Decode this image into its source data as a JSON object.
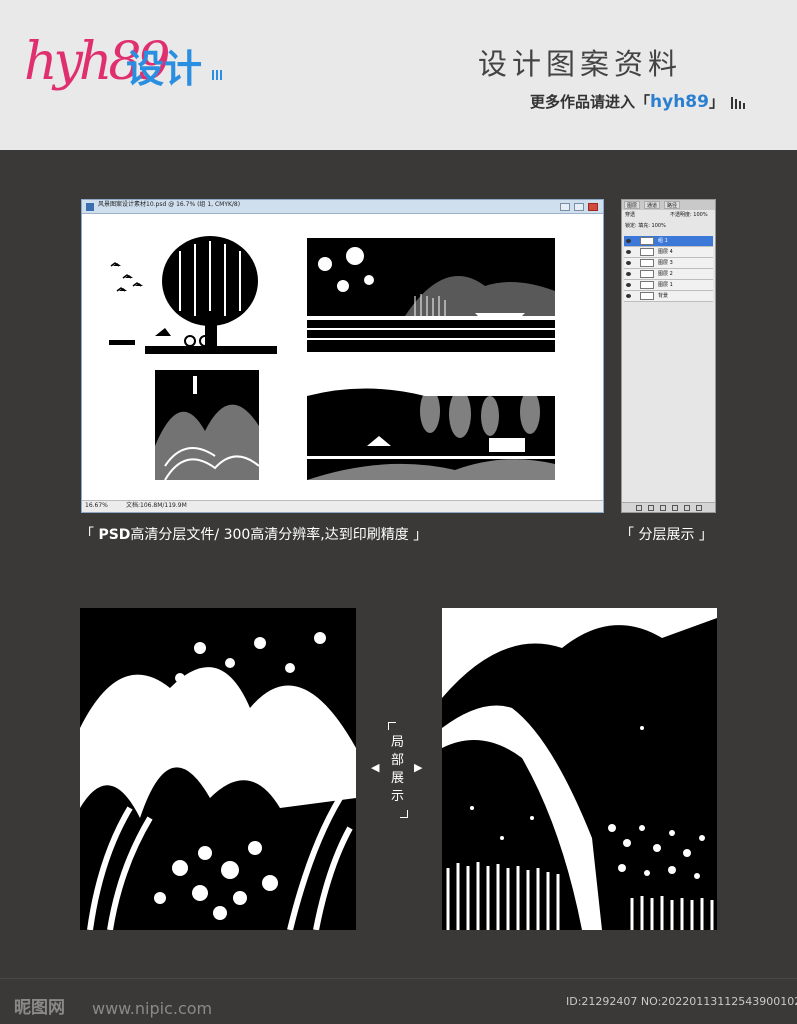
{
  "header": {
    "logo_latin": "hyh89",
    "logo_cn": "设计",
    "title": "设计图案资料",
    "subtitle_prefix": "更多作品请进入「",
    "subtitle_accent": "hyh89",
    "subtitle_suffix": "」"
  },
  "window": {
    "title": "风景图案设计素材10.psd @ 16.7% (组 1, CMYK/8)",
    "zoom": "16.67%",
    "doc_size": "文档:106.8M/119.9M"
  },
  "layers_panel": {
    "tabs": [
      "图层",
      "通道",
      "路径"
    ],
    "blend_mode": "穿透",
    "opacity": "不透明度: 100%",
    "lock": "锁定:   填充: 100%",
    "rows": [
      {
        "name": "组 1",
        "selected": true
      },
      {
        "name": "图层 4",
        "selected": false
      },
      {
        "name": "图层 3",
        "selected": false
      },
      {
        "name": "图层 2",
        "selected": false
      },
      {
        "name": "图层 1",
        "selected": false
      },
      {
        "name": "背景",
        "selected": false
      }
    ]
  },
  "captions": {
    "psd_open": "「 ",
    "psd_bold": "PSD",
    "psd_rest": "高清分层文件/ 300高清分辨率,达到印刷精度 」",
    "layers": "「 分层展示 」"
  },
  "local": {
    "text": "局部展示",
    "arrow_left": "◀",
    "arrow_right": "▶"
  },
  "watermark": {
    "site": "昵图网",
    "url": "www.nipic.com",
    "id": "ID:21292407 NO:20220113112543900102"
  },
  "colors": {
    "background": "#3a3938",
    "header": "#e9e9e9",
    "logo_pink": "#e02f6e",
    "logo_blue": "#2a8fe0",
    "accent_blue": "#2a7fd0"
  }
}
